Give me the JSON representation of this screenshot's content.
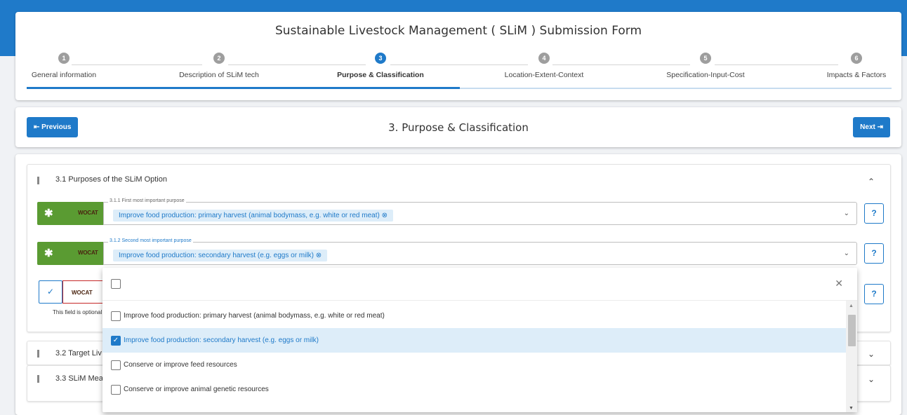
{
  "header": {
    "title": "Sustainable Livestock Management ( SLiM ) Submission Form"
  },
  "steps": [
    {
      "number": "1",
      "label": "General information"
    },
    {
      "number": "2",
      "label": "Description of SLiM tech"
    },
    {
      "number": "3",
      "label": "Purpose & Classification"
    },
    {
      "number": "4",
      "label": "Location-Extent-Context"
    },
    {
      "number": "5",
      "label": "Specification-Input-Cost"
    },
    {
      "number": "6",
      "label": "Impacts & Factors"
    }
  ],
  "active_step": 3,
  "nav": {
    "previous_label": "⇤ Previous",
    "next_label": "Next ⇥",
    "title": "3. Purpose & Classification"
  },
  "section_3_1": {
    "title": "3.1 Purposes of the SLiM Option",
    "wocat_label": "WOCAT",
    "field1": {
      "legend": "3.1.1 First most important purpose",
      "value": "Improve food production: primary harvest (animal bodymass, e.g. white or red meat)"
    },
    "field2": {
      "legend": "3.1.2 Second most important purpose",
      "value": "Improve food production: secondary harvest (e.g. eggs or milk)"
    },
    "help_label": "?",
    "optional_text": "This field is optional"
  },
  "section_3_2": {
    "title": "3.2 Target Liv"
  },
  "section_3_3": {
    "title": "3.3 SLiM Mea"
  },
  "dropdown": {
    "options": [
      {
        "label": "Improve food production: primary harvest (animal bodymass, e.g. white or red meat)",
        "checked": false
      },
      {
        "label": "Improve food production: secondary harvest (e.g. eggs or milk)",
        "checked": true
      },
      {
        "label": "Conserve or improve feed resources",
        "checked": false
      },
      {
        "label": "Conserve or improve animal genetic resources",
        "checked": false
      }
    ]
  },
  "colors": {
    "primary": "#1f7ac9",
    "wocat_green": "#5a9b32",
    "chip_bg": "#ddedf9"
  }
}
